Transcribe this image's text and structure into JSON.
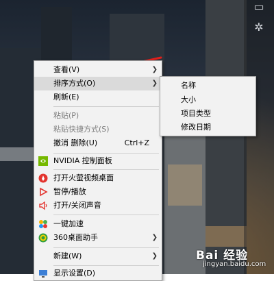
{
  "context_menu": {
    "items": [
      {
        "label": "查看(V)",
        "has_submenu": true
      },
      {
        "label": "排序方式(O)",
        "has_submenu": true,
        "highlighted": true
      },
      {
        "label": "刷新(E)"
      },
      {
        "label": "粘贴(P)",
        "disabled": true
      },
      {
        "label": "粘贴快捷方式(S)",
        "disabled": true
      },
      {
        "label": "撤消 删除(U)",
        "shortcut": "Ctrl+Z"
      },
      {
        "label": "NVIDIA 控制面板",
        "icon": "nvidia-icon"
      },
      {
        "label": "打开火萤视频桌面",
        "icon": "huoying-icon"
      },
      {
        "label": "暂停/播放",
        "icon": "play-icon"
      },
      {
        "label": "打开/关闭声音",
        "icon": "speaker-icon"
      },
      {
        "label": "一键加速",
        "icon": "boost-icon"
      },
      {
        "label": "360桌面助手",
        "icon": "360-icon",
        "has_submenu": true
      },
      {
        "label": "新建(W)",
        "has_submenu": true
      },
      {
        "label": "显示设置(D)",
        "icon": "display-icon"
      }
    ]
  },
  "sort_submenu": {
    "items": [
      {
        "label": "名称"
      },
      {
        "label": "大小"
      },
      {
        "label": "项目类型"
      },
      {
        "label": "修改日期"
      }
    ]
  },
  "watermark": {
    "logo": "Bai 经验",
    "url": "jingyan.baidu.com"
  },
  "colors": {
    "menu_bg": "#f2f2f2",
    "highlight": "#dadada",
    "annotation_arrow": "#e0201c",
    "nvidia": "#76b900"
  }
}
